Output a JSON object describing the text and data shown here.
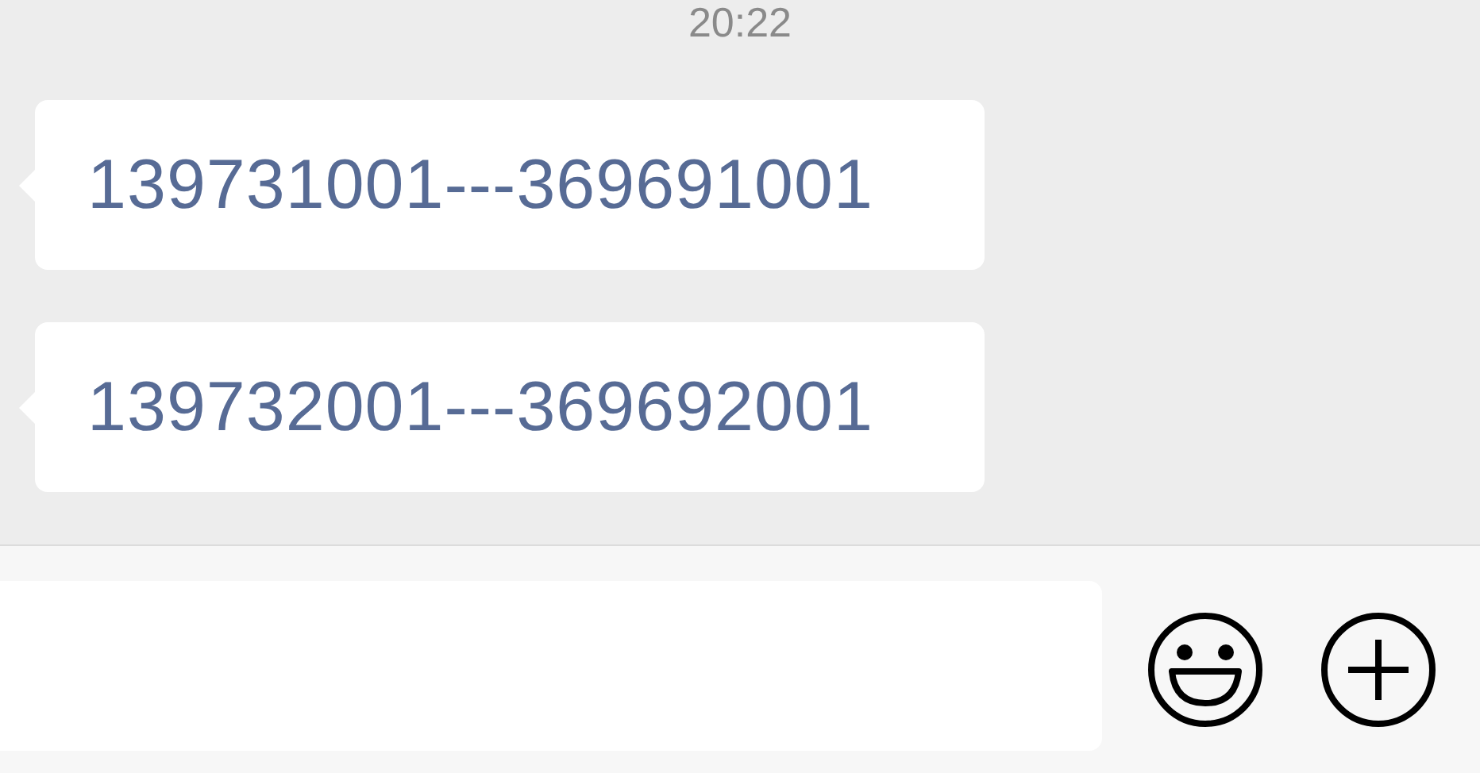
{
  "timestamp": "20:22",
  "messages": [
    {
      "text": "139731001---369691001"
    },
    {
      "text": "139732001---369692001"
    }
  ]
}
